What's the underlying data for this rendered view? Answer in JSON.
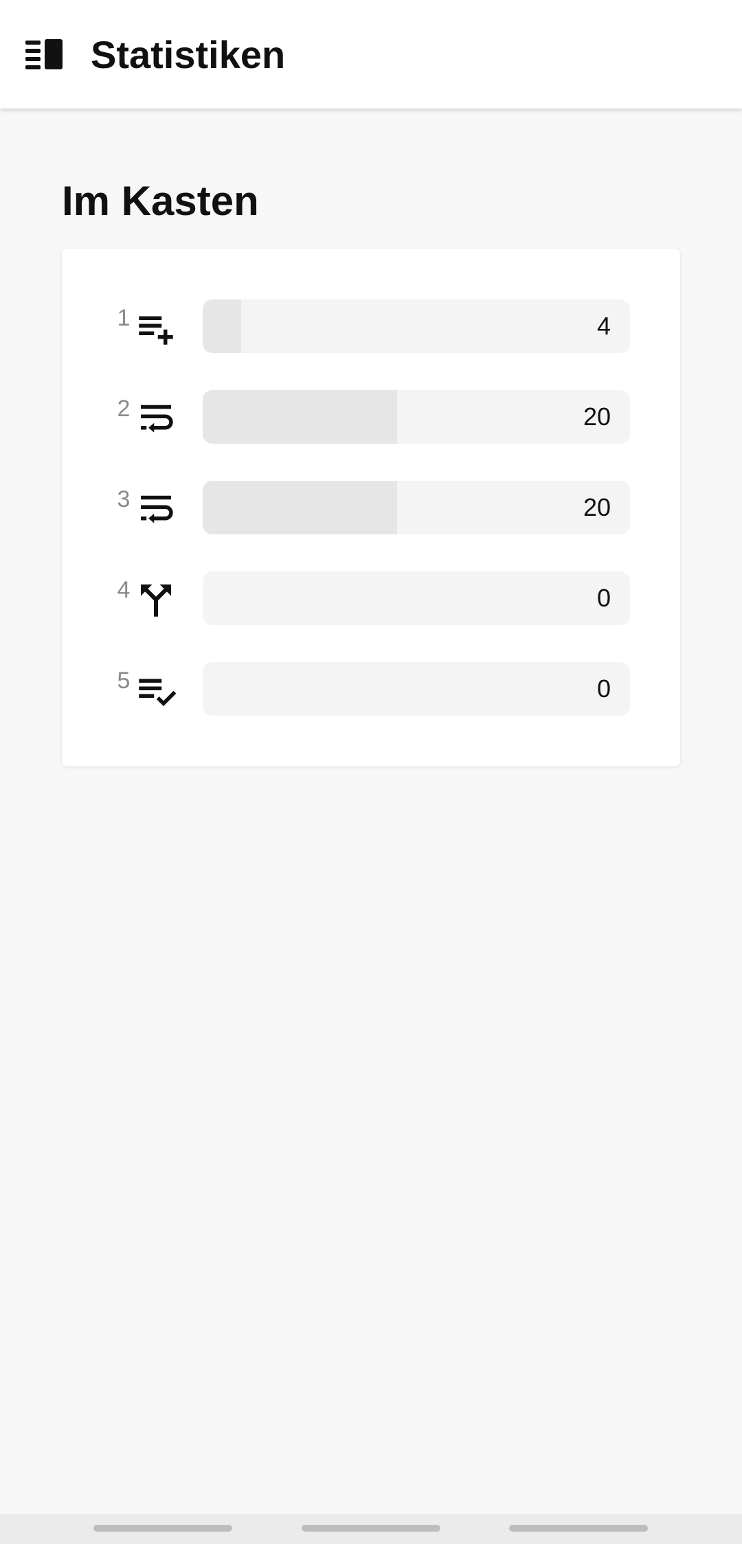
{
  "app_bar": {
    "title": "Statistiken",
    "menu_icon": "book-open-icon"
  },
  "section": {
    "title": "Im Kasten"
  },
  "boxes": [
    {
      "number": "1",
      "icon": "playlist-add-icon",
      "value": "4",
      "fill_fraction": 0.09
    },
    {
      "number": "2",
      "icon": "text-wrap-icon",
      "value": "20",
      "fill_fraction": 0.455
    },
    {
      "number": "3",
      "icon": "text-wrap-icon",
      "value": "20",
      "fill_fraction": 0.455
    },
    {
      "number": "4",
      "icon": "call-split-icon",
      "value": "0",
      "fill_fraction": 0
    },
    {
      "number": "5",
      "icon": "playlist-check-icon",
      "value": "0",
      "fill_fraction": 0
    }
  ],
  "colors": {
    "bar_track": "#f4f4f4",
    "bar_fill": "#e6e6e6",
    "background": "#f7f7f7"
  }
}
